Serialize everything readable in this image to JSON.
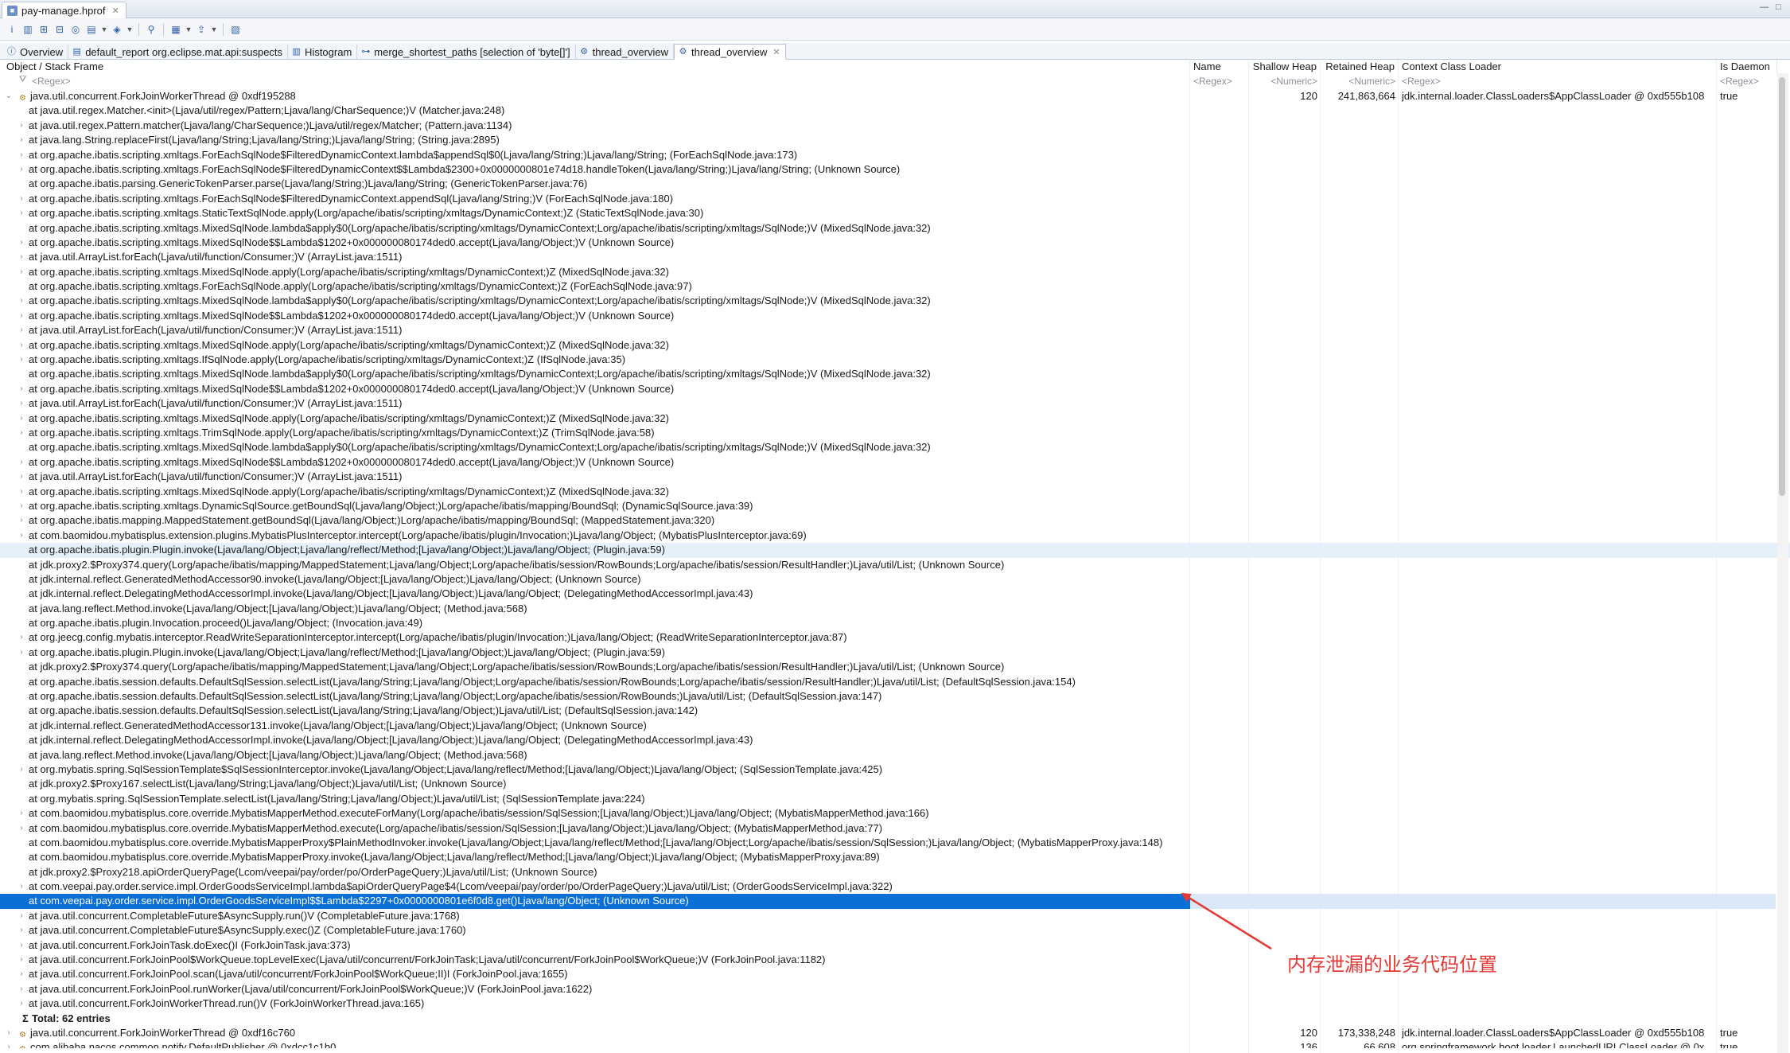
{
  "editor_tab": {
    "title": "pay-manage.hprof"
  },
  "view_tabs": [
    {
      "label": "Overview",
      "icon": "info-icon"
    },
    {
      "label": "default_report  org.eclipse.mat.api:suspects",
      "icon": "report-icon"
    },
    {
      "label": "Histogram",
      "icon": "histogram-icon"
    },
    {
      "label": "merge_shortest_paths [selection of 'byte[]']",
      "icon": "tree-icon"
    },
    {
      "label": "thread_overview",
      "icon": "thread-icon"
    },
    {
      "label": "thread_overview",
      "icon": "thread-icon",
      "active": true
    }
  ],
  "columns": {
    "object": "Object / Stack Frame",
    "name": "Name",
    "shallow": "Shallow Heap",
    "retained": "Retained Heap",
    "loader": "Context Class Loader",
    "daemon": "Is Daemon"
  },
  "filters": {
    "object": "<Regex>",
    "name": "<Regex>",
    "shallow": "<Numeric>",
    "retained": "<Numeric>",
    "loader": "<Regex>",
    "daemon": "<Regex>"
  },
  "thread1": {
    "label": "java.util.concurrent.ForkJoinWorkerThread @ 0xdf195288",
    "shallow": "120",
    "retained": "241,863,664",
    "loader": "jdk.internal.loader.ClassLoaders$AppClassLoader @ 0xd555b108",
    "daemon": "true"
  },
  "frames": [
    "at java.util.regex.Matcher.<init>(Ljava/util/regex/Pattern;Ljava/lang/CharSequence;)V (Matcher.java:248)",
    "at java.util.regex.Pattern.matcher(Ljava/lang/CharSequence;)Ljava/util/regex/Matcher; (Pattern.java:1134)",
    "at java.lang.String.replaceFirst(Ljava/lang/String;Ljava/lang/String;)Ljava/lang/String; (String.java:2895)",
    "at org.apache.ibatis.scripting.xmltags.ForEachSqlNode$FilteredDynamicContext.lambda$appendSql$0(Ljava/lang/String;)Ljava/lang/String; (ForEachSqlNode.java:173)",
    "at org.apache.ibatis.scripting.xmltags.ForEachSqlNode$FilteredDynamicContext$$Lambda$2300+0x0000000801e74d18.handleToken(Ljava/lang/String;)Ljava/lang/String; (Unknown Source)",
    "at org.apache.ibatis.parsing.GenericTokenParser.parse(Ljava/lang/String;)Ljava/lang/String; (GenericTokenParser.java:76)",
    "at org.apache.ibatis.scripting.xmltags.ForEachSqlNode$FilteredDynamicContext.appendSql(Ljava/lang/String;)V (ForEachSqlNode.java:180)",
    "at org.apache.ibatis.scripting.xmltags.StaticTextSqlNode.apply(Lorg/apache/ibatis/scripting/xmltags/DynamicContext;)Z (StaticTextSqlNode.java:30)",
    "at org.apache.ibatis.scripting.xmltags.MixedSqlNode.lambda$apply$0(Lorg/apache/ibatis/scripting/xmltags/DynamicContext;Lorg/apache/ibatis/scripting/xmltags/SqlNode;)V (MixedSqlNode.java:32)",
    "at org.apache.ibatis.scripting.xmltags.MixedSqlNode$$Lambda$1202+0x000000080174ded0.accept(Ljava/lang/Object;)V (Unknown Source)",
    "at java.util.ArrayList.forEach(Ljava/util/function/Consumer;)V (ArrayList.java:1511)",
    "at org.apache.ibatis.scripting.xmltags.MixedSqlNode.apply(Lorg/apache/ibatis/scripting/xmltags/DynamicContext;)Z (MixedSqlNode.java:32)",
    "at org.apache.ibatis.scripting.xmltags.ForEachSqlNode.apply(Lorg/apache/ibatis/scripting/xmltags/DynamicContext;)Z (ForEachSqlNode.java:97)",
    "at org.apache.ibatis.scripting.xmltags.MixedSqlNode.lambda$apply$0(Lorg/apache/ibatis/scripting/xmltags/DynamicContext;Lorg/apache/ibatis/scripting/xmltags/SqlNode;)V (MixedSqlNode.java:32)",
    "at org.apache.ibatis.scripting.xmltags.MixedSqlNode$$Lambda$1202+0x000000080174ded0.accept(Ljava/lang/Object;)V (Unknown Source)",
    "at java.util.ArrayList.forEach(Ljava/util/function/Consumer;)V (ArrayList.java:1511)",
    "at org.apache.ibatis.scripting.xmltags.MixedSqlNode.apply(Lorg/apache/ibatis/scripting/xmltags/DynamicContext;)Z (MixedSqlNode.java:32)",
    "at org.apache.ibatis.scripting.xmltags.IfSqlNode.apply(Lorg/apache/ibatis/scripting/xmltags/DynamicContext;)Z (IfSqlNode.java:35)",
    "at org.apache.ibatis.scripting.xmltags.MixedSqlNode.lambda$apply$0(Lorg/apache/ibatis/scripting/xmltags/DynamicContext;Lorg/apache/ibatis/scripting/xmltags/SqlNode;)V (MixedSqlNode.java:32)",
    "at org.apache.ibatis.scripting.xmltags.MixedSqlNode$$Lambda$1202+0x000000080174ded0.accept(Ljava/lang/Object;)V (Unknown Source)",
    "at java.util.ArrayList.forEach(Ljava/util/function/Consumer;)V (ArrayList.java:1511)",
    "at org.apache.ibatis.scripting.xmltags.MixedSqlNode.apply(Lorg/apache/ibatis/scripting/xmltags/DynamicContext;)Z (MixedSqlNode.java:32)",
    "at org.apache.ibatis.scripting.xmltags.TrimSqlNode.apply(Lorg/apache/ibatis/scripting/xmltags/DynamicContext;)Z (TrimSqlNode.java:58)",
    "at org.apache.ibatis.scripting.xmltags.MixedSqlNode.lambda$apply$0(Lorg/apache/ibatis/scripting/xmltags/DynamicContext;Lorg/apache/ibatis/scripting/xmltags/SqlNode;)V (MixedSqlNode.java:32)",
    "at org.apache.ibatis.scripting.xmltags.MixedSqlNode$$Lambda$1202+0x000000080174ded0.accept(Ljava/lang/Object;)V (Unknown Source)",
    "at java.util.ArrayList.forEach(Ljava/util/function/Consumer;)V (ArrayList.java:1511)",
    "at org.apache.ibatis.scripting.xmltags.MixedSqlNode.apply(Lorg/apache/ibatis/scripting/xmltags/DynamicContext;)Z (MixedSqlNode.java:32)",
    "at org.apache.ibatis.scripting.xmltags.DynamicSqlSource.getBoundSql(Ljava/lang/Object;)Lorg/apache/ibatis/mapping/BoundSql; (DynamicSqlSource.java:39)",
    "at org.apache.ibatis.mapping.MappedStatement.getBoundSql(Ljava/lang/Object;)Lorg/apache/ibatis/mapping/BoundSql; (MappedStatement.java:320)",
    "at com.baomidou.mybatisplus.extension.plugins.MybatisPlusInterceptor.intercept(Lorg/apache/ibatis/plugin/Invocation;)Ljava/lang/Object; (MybatisPlusInterceptor.java:69)",
    "at org.apache.ibatis.plugin.Plugin.invoke(Ljava/lang/Object;Ljava/lang/reflect/Method;[Ljava/lang/Object;)Ljava/lang/Object; (Plugin.java:59)",
    "at jdk.proxy2.$Proxy374.query(Lorg/apache/ibatis/mapping/MappedStatement;Ljava/lang/Object;Lorg/apache/ibatis/session/RowBounds;Lorg/apache/ibatis/session/ResultHandler;)Ljava/util/List; (Unknown Source)",
    "at jdk.internal.reflect.GeneratedMethodAccessor90.invoke(Ljava/lang/Object;[Ljava/lang/Object;)Ljava/lang/Object; (Unknown Source)",
    "at jdk.internal.reflect.DelegatingMethodAccessorImpl.invoke(Ljava/lang/Object;[Ljava/lang/Object;)Ljava/lang/Object; (DelegatingMethodAccessorImpl.java:43)",
    "at java.lang.reflect.Method.invoke(Ljava/lang/Object;[Ljava/lang/Object;)Ljava/lang/Object; (Method.java:568)",
    "at org.apache.ibatis.plugin.Invocation.proceed()Ljava/lang/Object; (Invocation.java:49)",
    "at org.jeecg.config.mybatis.interceptor.ReadWriteSeparationInterceptor.intercept(Lorg/apache/ibatis/plugin/Invocation;)Ljava/lang/Object; (ReadWriteSeparationInterceptor.java:87)",
    "at org.apache.ibatis.plugin.Plugin.invoke(Ljava/lang/Object;Ljava/lang/reflect/Method;[Ljava/lang/Object;)Ljava/lang/Object; (Plugin.java:59)",
    "at jdk.proxy2.$Proxy374.query(Lorg/apache/ibatis/mapping/MappedStatement;Ljava/lang/Object;Lorg/apache/ibatis/session/RowBounds;Lorg/apache/ibatis/session/ResultHandler;)Ljava/util/List; (Unknown Source)",
    "at org.apache.ibatis.session.defaults.DefaultSqlSession.selectList(Ljava/lang/String;Ljava/lang/Object;Lorg/apache/ibatis/session/RowBounds;Lorg/apache/ibatis/session/ResultHandler;)Ljava/util/List; (DefaultSqlSession.java:154)",
    "at org.apache.ibatis.session.defaults.DefaultSqlSession.selectList(Ljava/lang/String;Ljava/lang/Object;Lorg/apache/ibatis/session/RowBounds;)Ljava/util/List; (DefaultSqlSession.java:147)",
    "at org.apache.ibatis.session.defaults.DefaultSqlSession.selectList(Ljava/lang/String;Ljava/lang/Object;)Ljava/util/List; (DefaultSqlSession.java:142)",
    "at jdk.internal.reflect.GeneratedMethodAccessor131.invoke(Ljava/lang/Object;[Ljava/lang/Object;)Ljava/lang/Object; (Unknown Source)",
    "at jdk.internal.reflect.DelegatingMethodAccessorImpl.invoke(Ljava/lang/Object;[Ljava/lang/Object;)Ljava/lang/Object; (DelegatingMethodAccessorImpl.java:43)",
    "at java.lang.reflect.Method.invoke(Ljava/lang/Object;[Ljava/lang/Object;)Ljava/lang/Object; (Method.java:568)",
    "at org.mybatis.spring.SqlSessionTemplate$SqlSessionInterceptor.invoke(Ljava/lang/Object;Ljava/lang/reflect/Method;[Ljava/lang/Object;)Ljava/lang/Object; (SqlSessionTemplate.java:425)",
    "at jdk.proxy2.$Proxy167.selectList(Ljava/lang/String;Ljava/lang/Object;)Ljava/util/List; (Unknown Source)",
    "at org.mybatis.spring.SqlSessionTemplate.selectList(Ljava/lang/String;Ljava/lang/Object;)Ljava/util/List; (SqlSessionTemplate.java:224)",
    "at com.baomidou.mybatisplus.core.override.MybatisMapperMethod.executeForMany(Lorg/apache/ibatis/session/SqlSession;[Ljava/lang/Object;)Ljava/lang/Object; (MybatisMapperMethod.java:166)",
    "at com.baomidou.mybatisplus.core.override.MybatisMapperMethod.execute(Lorg/apache/ibatis/session/SqlSession;[Ljava/lang/Object;)Ljava/lang/Object; (MybatisMapperMethod.java:77)",
    "at com.baomidou.mybatisplus.core.override.MybatisMapperProxy$PlainMethodInvoker.invoke(Ljava/lang/Object;Ljava/lang/reflect/Method;[Ljava/lang/Object;Lorg/apache/ibatis/session/SqlSession;)Ljava/lang/Object; (MybatisMapperProxy.java:148)",
    "at com.baomidou.mybatisplus.core.override.MybatisMapperProxy.invoke(Ljava/lang/Object;Ljava/lang/reflect/Method;[Ljava/lang/Object;)Ljava/lang/Object; (MybatisMapperProxy.java:89)",
    "at jdk.proxy2.$Proxy218.apiOrderQueryPage(Lcom/veepai/pay/order/po/OrderPageQuery;)Ljava/util/List; (Unknown Source)",
    "at com.veepai.pay.order.service.impl.OrderGoodsServiceImpl.lambda$apiOrderQueryPage$4(Lcom/veepai/pay/order/po/OrderPageQuery;)Ljava/util/List; (OrderGoodsServiceImpl.java:322)",
    "at com.veepai.pay.order.service.impl.OrderGoodsServiceImpl$$Lambda$2297+0x0000000801e6f0d8.get()Ljava/lang/Object; (Unknown Source)",
    "at java.util.concurrent.CompletableFuture$AsyncSupply.run()V (CompletableFuture.java:1768)",
    "at java.util.concurrent.CompletableFuture$AsyncSupply.exec()Z (CompletableFuture.java:1760)",
    "at java.util.concurrent.ForkJoinTask.doExec()I (ForkJoinTask.java:373)",
    "at java.util.concurrent.ForkJoinPool$WorkQueue.topLevelExec(Ljava/util/concurrent/ForkJoinTask;Ljava/util/concurrent/ForkJoinPool$WorkQueue;)V (ForkJoinPool.java:1182)",
    "at java.util.concurrent.ForkJoinPool.scan(Ljava/util/concurrent/ForkJoinPool$WorkQueue;II)I (ForkJoinPool.java:1655)",
    "at java.util.concurrent.ForkJoinPool.runWorker(Ljava/util/concurrent/ForkJoinPool$WorkQueue;)V (ForkJoinPool.java:1622)",
    "at java.util.concurrent.ForkJoinWorkerThread.run()V (ForkJoinWorkerThread.java:165)"
  ],
  "expandable_frames": [
    1,
    2,
    3,
    4,
    6,
    7,
    9,
    10,
    11,
    13,
    14,
    15,
    16,
    17,
    19,
    20,
    21,
    22,
    24,
    25,
    26,
    27,
    28,
    29,
    36,
    37,
    45,
    48,
    49,
    53,
    55,
    56,
    57,
    58,
    59,
    60,
    61,
    62
  ],
  "hover_frame": 30,
  "selected_frame": 54,
  "total_label": "Total: 62 entries",
  "thread2": {
    "label": "java.util.concurrent.ForkJoinWorkerThread @ 0xdf16c760",
    "shallow": "120",
    "retained": "173,338,248",
    "loader": "jdk.internal.loader.ClassLoaders$AppClassLoader @ 0xd555b108",
    "daemon": "true"
  },
  "thread3": {
    "label": "com.alibaba.nacos.common.notify.DefaultPublisher @ 0xdcc1c1b0",
    "shallow": "136",
    "retained": "66,608",
    "loader": "org.springframework.boot.loader.LaunchedURLClassLoader @ 0x",
    "daemon": "true"
  },
  "annotation": {
    "text": "内存泄漏的业务代码位置",
    "color": "#e53935"
  }
}
